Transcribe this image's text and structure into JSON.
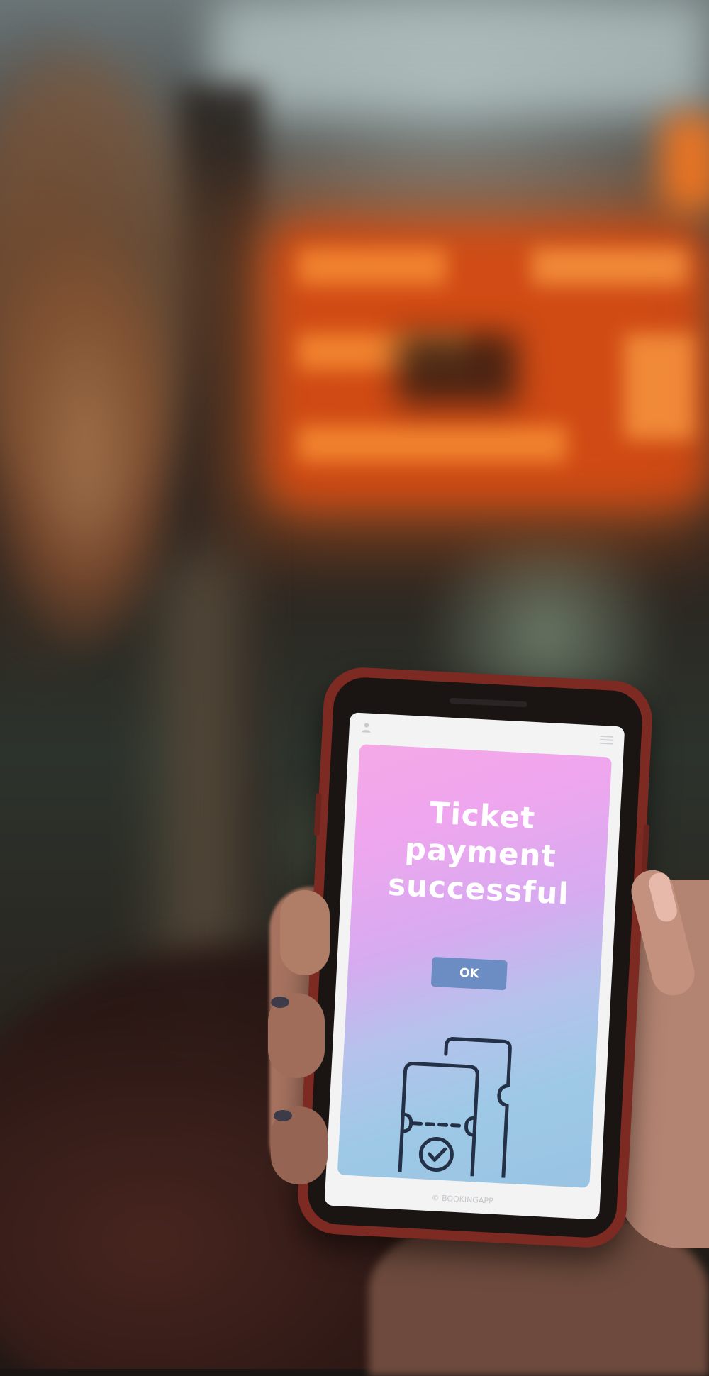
{
  "photo": {
    "subject": "hand-holding-phone",
    "accent_colors": {
      "sign_orange": "#ff6a1a",
      "card_pink": "#f4a8e6",
      "card_blue": "#99c3e2",
      "button_blue": "#6c8cc4",
      "phone_case": "#7d2a23"
    }
  },
  "phone_app": {
    "title_lines": [
      "Ticket",
      "payment",
      "successful"
    ],
    "ok_label": "OK",
    "footer": "© BOOKINGAPP",
    "icons": {
      "top_left": "user-icon",
      "top_right": "menu-icon",
      "illustration": "ticket-check-icon"
    }
  }
}
